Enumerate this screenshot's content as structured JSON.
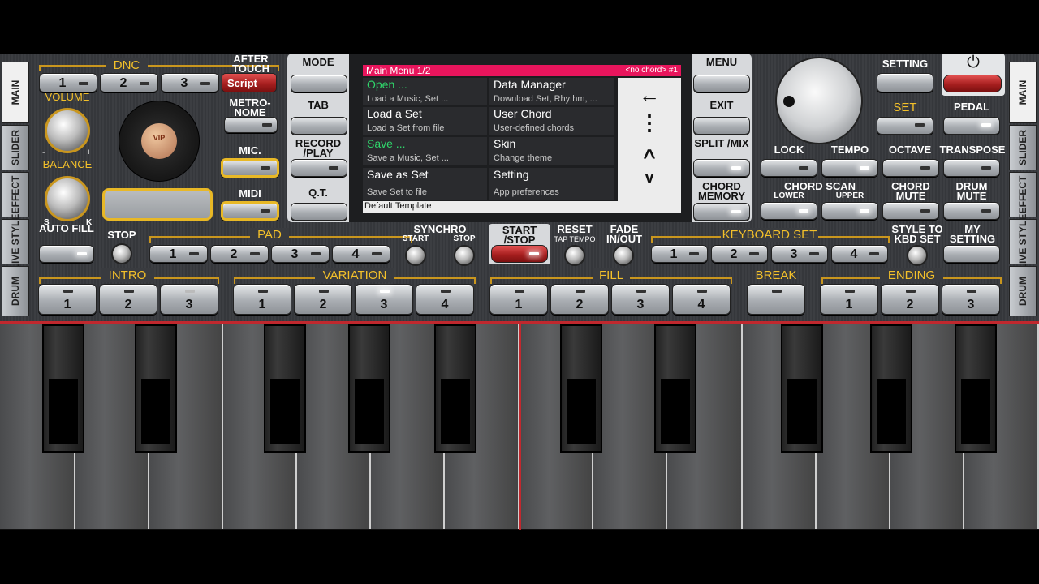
{
  "left_tabs": [
    "MAIN",
    "SLIDER",
    "EFFECT",
    "LIVE STYLE",
    "DRUM"
  ],
  "right_tabs": [
    "MAIN",
    "SLIDER",
    "EFFECT",
    "LIVE STYLE",
    "DRUM"
  ],
  "dnc": {
    "label": "DNC",
    "buttons": [
      "1",
      "2",
      "3"
    ],
    "script": "Script"
  },
  "labels": {
    "after_touch": "AFTER TOUCH",
    "metronome": "METRO- NOME",
    "mic": "MIC.",
    "midi": "MIDI",
    "volume": "VOLUME",
    "balance": "BALANCE",
    "balance_s": "S",
    "balance_k": "K",
    "minus": "-",
    "plus": "+",
    "mode": "MODE",
    "tab": "TAB",
    "record_play": "RECORD /PLAY",
    "qt": "Q.T.",
    "menu": "MENU",
    "exit": "EXIT",
    "split_mix": "SPLIT /MIX",
    "chord_memory": "CHORD MEMORY",
    "setting": "SETTING",
    "set": "SET",
    "pedal": "PEDAL",
    "lock": "LOCK",
    "tempo": "TEMPO",
    "octave": "OCTAVE",
    "transpose": "TRANSPOSE",
    "chord_scan": "CHORD SCAN",
    "lower": "LOWER",
    "upper": "UPPER",
    "chord_mute": "CHORD MUTE",
    "drum_mute": "DRUM MUTE",
    "auto_fill": "AUTO FILL",
    "stop": "STOP",
    "pad": "PAD",
    "synchro": "SYNCHRO",
    "synchro_start": "START",
    "synchro_stop": "STOP",
    "start_stop": "START /STOP",
    "reset": "RESET",
    "tap_tempo": "TAP TEMPO",
    "fade": "FADE IN/OUT",
    "keyboard_set": "KEYBOARD SET",
    "style_to_kbd": "STYLE TO KBD SET",
    "my_setting": "MY SETTING",
    "intro": "INTRO",
    "variation": "VARIATION",
    "fill": "FILL",
    "break": "BREAK",
    "ending": "ENDING",
    "vip": "VIP"
  },
  "pad_buttons": [
    "1",
    "2",
    "3",
    "4"
  ],
  "keyboard_set_buttons": [
    "1",
    "2",
    "3",
    "4"
  ],
  "intro_buttons": [
    "1",
    "2",
    "3"
  ],
  "variation_buttons": [
    "1",
    "2",
    "3",
    "4"
  ],
  "fill_buttons": [
    "1",
    "2",
    "3",
    "4"
  ],
  "ending_buttons": [
    "1",
    "2",
    "3"
  ],
  "screen": {
    "title": "Main Menu  1/2",
    "chord_status": "<no chord> #1",
    "items": [
      {
        "title": "Open ...",
        "sub": "Load a Music, Set ..."
      },
      {
        "title": "Data Manager",
        "sub": "Download Set, Rhythm, ..."
      },
      {
        "title": "Load a Set",
        "sub": "Load a Set from file"
      },
      {
        "title": "User Chord",
        "sub": "User-defined chords"
      },
      {
        "title": "Save ...",
        "sub": "Save a Music, Set ..."
      },
      {
        "title": "Skin",
        "sub": "Change theme"
      },
      {
        "title": "Save as Set",
        "sub": "Save Set to file"
      },
      {
        "title": "Setting",
        "sub": "App preferences"
      }
    ],
    "footer": "Default.Template",
    "nav": {
      "back": "←",
      "more": "⋮",
      "up": "^",
      "down": "v"
    }
  },
  "power_icon": "⏻",
  "colors": {
    "accent_gold": "#f3c02a",
    "menu_header": "#e8155c",
    "highlight_green": "#2fd66b"
  }
}
